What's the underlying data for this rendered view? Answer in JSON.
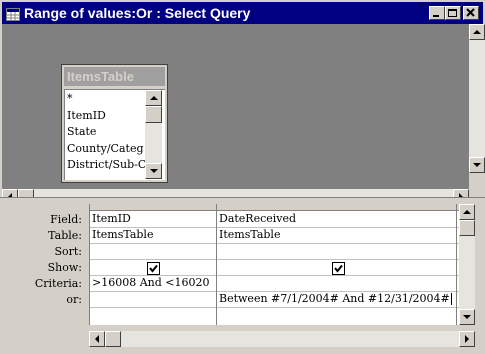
{
  "window": {
    "title": "Range of values:Or : Select Query",
    "icon": "query-window-icon",
    "controls": [
      "minimize-icon",
      "restore-icon",
      "close-icon"
    ]
  },
  "field_list": {
    "table_name": "ItemsTable",
    "fields": [
      "*",
      "ItemID",
      "State",
      "County/Categ",
      "District/Sub-C"
    ]
  },
  "grid": {
    "row_labels": [
      "Field:",
      "Table:",
      "Sort:",
      "Show:",
      "Criteria:",
      "or:"
    ],
    "columns": [
      {
        "field": "ItemID",
        "table": "ItemsTable",
        "sort": "",
        "show": true,
        "criteria": ">16008 And <16020",
        "or": ""
      },
      {
        "field": "DateReceived",
        "table": "ItemsTable",
        "sort": "",
        "show": true,
        "criteria": "",
        "or": "Between #7/1/2004# And #12/31/2004#"
      },
      {
        "field": "",
        "table": "",
        "sort": "",
        "show": false,
        "criteria": "",
        "or": ""
      }
    ]
  },
  "colors": {
    "titlebar": "#000080",
    "face": "#d4d0c8",
    "upper_pane": "#808080"
  }
}
